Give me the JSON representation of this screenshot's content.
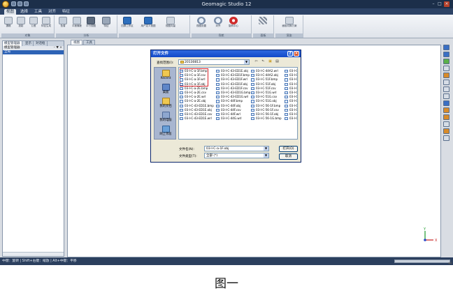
{
  "app": {
    "title": "Geomagic Studio 12",
    "window_controls": [
      "–",
      "□",
      "×"
    ]
  },
  "menu_tabs": [
    "视图",
    "选择",
    "工具",
    "对齐",
    "特征"
  ],
  "ribbon": {
    "groups": [
      {
        "label": "对象",
        "buttons": [
          "選格",
          "投影",
          "公差",
          "特征生成"
        ]
      },
      {
        "label": "分析",
        "buttons": [
          "色谱",
          "平面偏差",
          "平行视图",
          "特征"
        ]
      },
      {
        "label": "",
        "buttons": [
          "四屏工作区",
          "用户定义视图",
          "视图向量"
        ]
      },
      {
        "label": "导航",
        "buttons": [
          "视图设置",
          "对齐",
          "旋转中心"
        ]
      },
      {
        "label": "面板",
        "buttons": [
          ""
        ]
      },
      {
        "label": "渲染",
        "buttons": [
          "面板切换方案"
        ]
      }
    ]
  },
  "left_panel": {
    "tabs": [
      "模型管理器",
      "显示",
      "对话框"
    ],
    "header": "模型管理器",
    "header_controls": "– ▼ ×",
    "selected_item": "全局"
  },
  "view_tabs": [
    "视图",
    "工具"
  ],
  "status_bar": "中键：旋转 | Shift+右键：缩放 | Alt+中键：平移",
  "dialog": {
    "title": "打开文件",
    "lookin_label": "查找范围(I):",
    "lookin_value": "20130813",
    "places": [
      "Recent",
      "桌面",
      "我的文档",
      "我的电脑",
      "网上邻居"
    ],
    "file_columns": [
      [
        "03-I-C-a-1F.bmp",
        "03-I-C-a-1F.csv",
        "03-I-C-a-1F.wrl",
        "03-I-C-a-1F.obj",
        "03-I-C-a-2E.bmp",
        "03-I-C-a-2E.csv",
        "03-I-C-a-2E.wrl",
        "03-I-C-a-2E.obj",
        "03-I-C-43-ED1E.bmp",
        "03-I-C-43-ED1E.obj",
        "03-I-C-43-ED1E.csv",
        "03-I-C-43-ED1E.wrl"
      ],
      [
        "03-I-C-43-ED1E.obj",
        "03-I-C-43-ED1F.bmp",
        "03-I-C-43-ED1F.wrl",
        "03-I-C-43-ED1F.obj",
        "03-I-C-43-ED1F.csv",
        "03-I-C-43-ED1G.bmp",
        "03-I-C-43-ED1G.wrl",
        "03-I-C-44F.bmp",
        "03-I-C-44F.obj",
        "03-I-C-44F.csv",
        "03-I-C-44F.wrl",
        "03-I-C-44G.wrl"
      ],
      [
        "03-I-C-44A2.wrl",
        "03-I-C-44A2.obj",
        "03-I-C-51F.bmp",
        "03-I-C-51F.obj",
        "03-I-C-51F.csv",
        "03-I-C-51G.wrl",
        "03-I-C-51G.csv",
        "03-I-C-51G.obj",
        "03-I-C-56-1F.bmp",
        "03-I-C-56-1F.csv",
        "03-I-C-56-1F.obj",
        "03-I-C-56-1G.bmp"
      ],
      [
        "03-I-C-",
        "03-I-C-",
        "03-I-C-",
        "03-I-C-",
        "03-I-C-",
        "03-I-C-",
        "03-I-C-",
        "03-I-C-",
        "03-I-C-",
        "03-I-C-",
        "03-I-C-",
        "03-I-C-"
      ]
    ],
    "filename_label": "文件名(N):",
    "filename_value": "03-I-C-a-1F.obj",
    "filetype_label": "文件类型(T):",
    "filetype_value": "全部 (*)",
    "open_button": "打开(O)",
    "cancel_button": "取消"
  },
  "axes": {
    "y": "Y",
    "x": "X"
  },
  "caption": "图一",
  "colors": {
    "titlebar": "#1c2f4a",
    "dialog_title": "#1149c8",
    "highlight_box": "#d9232a",
    "selection": "#2e63b6"
  }
}
